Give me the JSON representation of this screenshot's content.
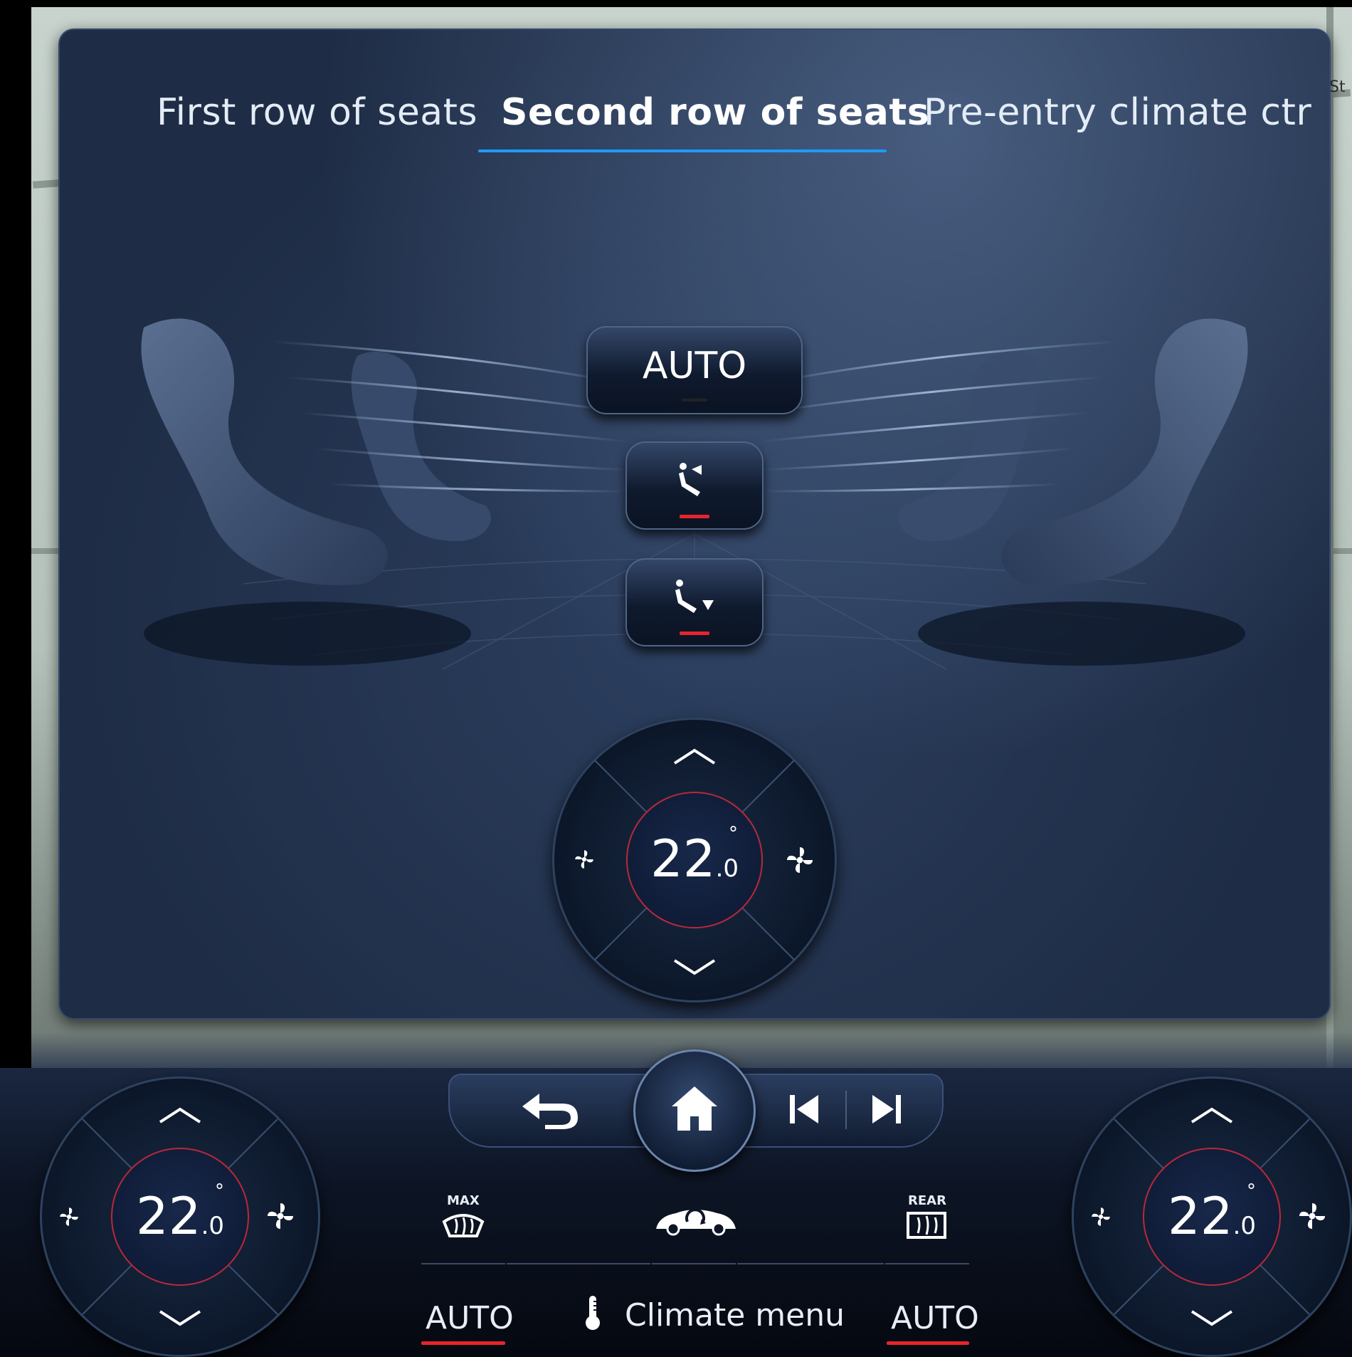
{
  "map": {
    "street_fragment": "St"
  },
  "tabs": [
    {
      "label": "First row of seats",
      "active": false
    },
    {
      "label": "Second row of seats",
      "active": true
    },
    {
      "label": "Pre-entry climate ctr",
      "active": false
    }
  ],
  "center": {
    "auto_label": "AUTO",
    "seat_upper_icon": "seat-airflow-upper-icon",
    "seat_lower_icon": "seat-airflow-lower-icon",
    "active_color": "#e8232d"
  },
  "rear_dial": {
    "temp_whole": "22",
    "temp_decimal": ".0",
    "degree": "°",
    "up_icon": "chevron-up-icon",
    "down_icon": "chevron-down-icon"
  },
  "left_dial": {
    "temp_whole": "22",
    "temp_decimal": ".0",
    "degree": "°"
  },
  "right_dial": {
    "temp_whole": "22",
    "temp_decimal": ".0",
    "degree": "°"
  },
  "nav": {
    "back_icon": "back-arrow-icon",
    "home_icon": "home-icon",
    "prev_icon": "skip-previous-icon",
    "next_icon": "skip-next-icon"
  },
  "bottom": {
    "max_label": "MAX",
    "rear_label": "REAR",
    "auto_left": "AUTO",
    "auto_right": "AUTO",
    "climate_menu": "Climate menu"
  },
  "colors": {
    "accent_blue": "#1f9bff",
    "active_red": "#e8232d",
    "panel_bg": "#1e2c45"
  }
}
